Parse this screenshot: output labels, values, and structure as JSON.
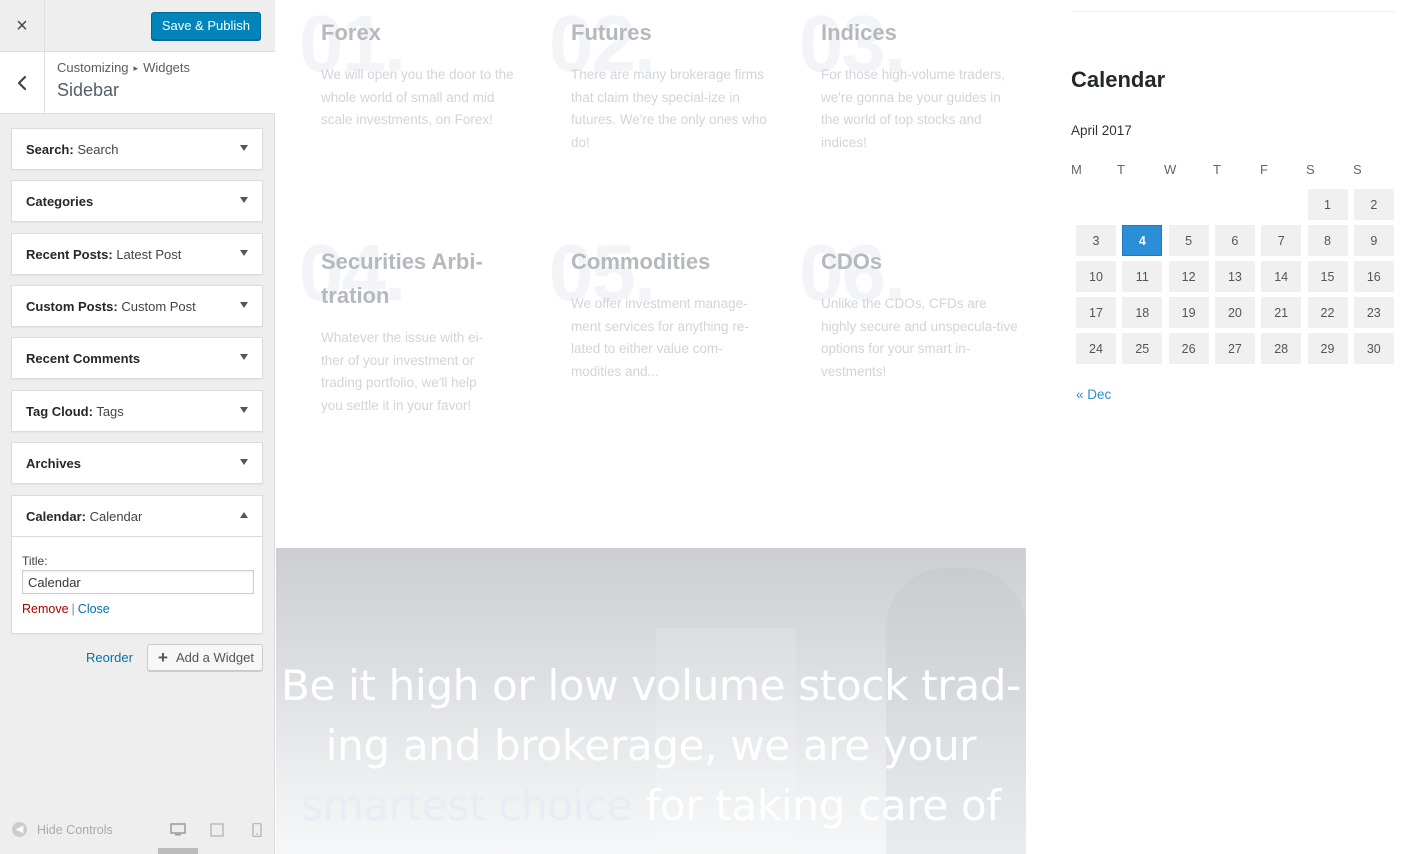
{
  "header": {
    "close_icon": "×",
    "publish_label": "Save & Publish"
  },
  "section": {
    "breadcrumb_parent": "Customizing",
    "breadcrumb_sep": "▸",
    "breadcrumb_child": "Widgets",
    "title": "Sidebar"
  },
  "widgets": [
    {
      "type": "Search:",
      "title": "Search"
    },
    {
      "type": "Categories",
      "title": ""
    },
    {
      "type": "Recent Posts:",
      "title": "Latest Post"
    },
    {
      "type": "Custom Posts:",
      "title": "Custom Post"
    },
    {
      "type": "Recent Comments",
      "title": ""
    },
    {
      "type": "Tag Cloud:",
      "title": "Tags"
    },
    {
      "type": "Archives",
      "title": ""
    },
    {
      "type": "Calendar:",
      "title": "Calendar"
    }
  ],
  "calendar_form": {
    "title_label": "Title:",
    "title_value": "Calendar",
    "remove_label": "Remove",
    "separator": "|",
    "close_label": "Close"
  },
  "actions": {
    "reorder_label": "Reorder",
    "add_widget_label": "Add a Widget"
  },
  "footer": {
    "hide_controls_label": "Hide Controls"
  },
  "preview": {
    "services": [
      {
        "num": "01.",
        "title": "Forex",
        "text": "We will open you the door to the whole world of small and mid scale investments, on Forex!"
      },
      {
        "num": "02.",
        "title": "Futures",
        "text": "There are many brokerage firms that claim they special-ize in futures. We're the only ones who do!"
      },
      {
        "num": "03.",
        "title": "Indices",
        "text": "For those high-volume traders, we're gonna be your guides in the world of top stocks and indices!"
      },
      {
        "num": "04.",
        "title": "Securities Arbi-tration",
        "text": "Whatever the issue with ei-ther of your investment or trading portfolio, we'll help you settle it in your favor!"
      },
      {
        "num": "05.",
        "title": "Commodities",
        "text": "We offer investment manage-ment services for anything re-lated to either value com-modities and..."
      },
      {
        "num": "06.",
        "title": "CDOs",
        "text": "Unlike the CDOs, CFDs are highly secure and unspecula-tive options for your smart in-vestments!"
      }
    ],
    "hero": {
      "line1": "Be it high or low volume stock trad-",
      "line2": "ing and brokerage, we are your",
      "highlight": "smartest choice",
      "line3_rest": " for taking care of"
    },
    "calendar": {
      "heading": "Calendar",
      "caption": "April 2017",
      "day_headers": [
        "M",
        "T",
        "W",
        "T",
        "F",
        "S",
        "S"
      ],
      "weeks": [
        [
          "",
          "",
          "",
          "",
          "",
          "1",
          "2"
        ],
        [
          "3",
          "4",
          "5",
          "6",
          "7",
          "8",
          "9"
        ],
        [
          "10",
          "11",
          "12",
          "13",
          "14",
          "15",
          "16"
        ],
        [
          "17",
          "18",
          "19",
          "20",
          "21",
          "22",
          "23"
        ],
        [
          "24",
          "25",
          "26",
          "27",
          "28",
          "29",
          "30"
        ]
      ],
      "today": "4",
      "prev_link": "« Dec"
    }
  }
}
